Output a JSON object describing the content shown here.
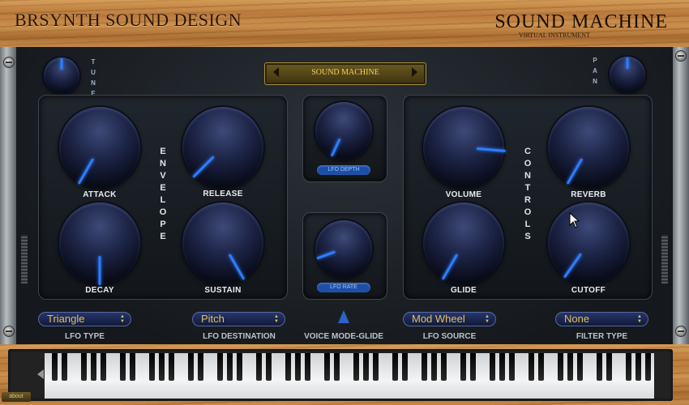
{
  "header": {
    "brand": "BRSYNTH SOUND DESIGN",
    "product": "SOUND MACHINE",
    "product_subtitle": "VIRTUAL INSTRUMENT"
  },
  "preset": {
    "name": "SOUND MACHINE"
  },
  "tune": {
    "label": "T\nU\nN\nE",
    "value_deg": 0
  },
  "pan": {
    "label": "P\nA\nN",
    "value_deg": 0
  },
  "envelope": {
    "title": "E\nN\nV\nE\nL\nO\nP\nE",
    "knobs": [
      {
        "label": "ATTACK",
        "value_deg": -150
      },
      {
        "label": "RELEASE",
        "value_deg": -135
      },
      {
        "label": "DECAY",
        "value_deg": 180
      },
      {
        "label": "SUSTAIN",
        "value_deg": 150
      }
    ]
  },
  "lfo": {
    "depth": {
      "label": "LFO DEPTH",
      "value_deg": -155
    },
    "rate": {
      "label": "LFO RATE",
      "value_deg": -110
    }
  },
  "controls": {
    "title": "C\nO\nN\nT\nR\nO\nL\nS",
    "knobs": [
      {
        "label": "VOLUME",
        "value_deg": 95
      },
      {
        "label": "REVERB",
        "value_deg": -150
      },
      {
        "label": "GLIDE",
        "value_deg": -150
      },
      {
        "label": "CUTOFF",
        "value_deg": -145
      }
    ]
  },
  "footer": {
    "lfo_type": {
      "label": "LFO TYPE",
      "value": "Triangle"
    },
    "lfo_destination": {
      "label": "LFO DESTINATION",
      "value": "Pitch"
    },
    "voice_mode": {
      "label": "VOICE MODE-GLIDE"
    },
    "lfo_source": {
      "label": "LFO SOURCE",
      "value": "Mod Wheel"
    },
    "filter_type": {
      "label": "FILTER TYPE",
      "value": "None"
    }
  },
  "about_label": "about",
  "colors": {
    "accent": "#2d7dff",
    "gold": "#f1d264",
    "panel": "#15181c"
  }
}
